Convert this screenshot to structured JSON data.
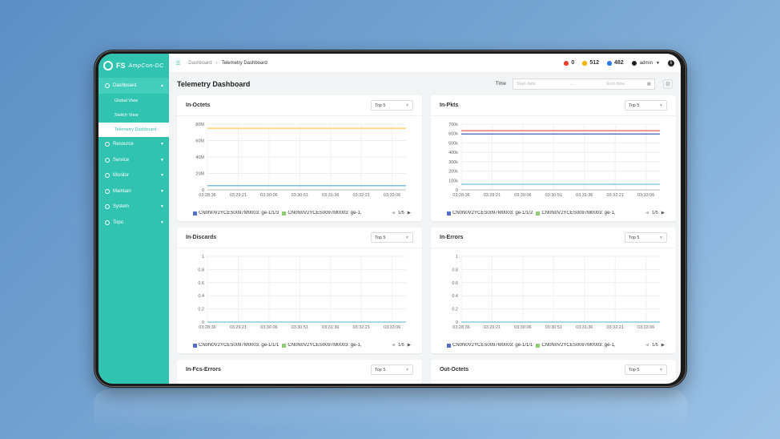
{
  "sidebar": {
    "logo": "FS",
    "product": "AmpCon-DC",
    "items": [
      {
        "label": "Dashboard",
        "icon": "dashboard-icon",
        "open": true,
        "children": [
          {
            "label": "Global View"
          },
          {
            "label": "Switch View"
          },
          {
            "label": "Telemetry Dashboard",
            "active": true
          }
        ]
      },
      {
        "label": "Resource",
        "icon": "globe-icon"
      },
      {
        "label": "Service",
        "icon": "service-icon"
      },
      {
        "label": "Monitor",
        "icon": "monitor-icon"
      },
      {
        "label": "Maintain",
        "icon": "tools-icon"
      },
      {
        "label": "System",
        "icon": "gear-icon"
      },
      {
        "label": "Topo",
        "icon": "topo-icon"
      }
    ]
  },
  "topbar": {
    "breadcrumb": [
      "Dashboard",
      "Telemetry Dashboard"
    ],
    "alerts": [
      {
        "icon": "fire-icon",
        "value": "0",
        "color": "#e8412c"
      },
      {
        "icon": "warning-bell-icon",
        "value": "512",
        "color": "#f5b200"
      },
      {
        "icon": "bell-icon",
        "value": "482",
        "color": "#2f7be6"
      }
    ],
    "user": "admin"
  },
  "page": {
    "title": "Telemetry Dashboard",
    "time_label": "Time",
    "start_placeholder": "Start date",
    "end_placeholder": "End date"
  },
  "colors": {
    "accent": "#30c3b0",
    "series_blue": "#5470c6",
    "series_green": "#91cc75",
    "series_yellow": "#fac858",
    "series_red": "#ee6666",
    "series_teal": "#73c0de"
  },
  "cards": [
    {
      "title": "In-Octets",
      "select": "Top 5",
      "legend": [
        "CN0N0V2YCES0097M0003: ge-1/1/3",
        "CN0N0V2YCES0097M0003: ge-1,"
      ],
      "page": "1/5"
    },
    {
      "title": "In-Pkts",
      "select": "Top 5",
      "legend": [
        "CN0N0V2YCES0097M0003: ge-1/1/2",
        "CN0N0V2YCES0097M0003: ge-1,"
      ],
      "page": "1/5"
    },
    {
      "title": "In-Discards",
      "select": "Top 5",
      "legend": [
        "CN0N0V2YCES0097M0003: ge-1/1/1",
        "CN0N0V2YCES0097M0003: ge-1,"
      ],
      "page": "1/5"
    },
    {
      "title": "In-Errors",
      "select": "Top 5",
      "legend": [
        "CN0N0V2YCES0097M0003: ge-1/1/1",
        "CN0N0V2YCES0097M0003: ge-1,"
      ],
      "page": "1/5"
    },
    {
      "title": "In-Fcs-Errors",
      "select": "Top 5"
    },
    {
      "title": "Out-Octets",
      "select": "Top 5"
    }
  ],
  "chart_data": [
    {
      "type": "line",
      "title": "In-Octets",
      "categories": [
        "03:28:36",
        "03:29:21",
        "03:30:06",
        "03:30:51",
        "03:31:36",
        "03:32:21",
        "03:33:06"
      ],
      "yticks": [
        "0",
        "20M",
        "40M",
        "60M",
        "80M"
      ],
      "ylim": [
        0,
        80000000
      ],
      "series": [
        {
          "color": "#fac858",
          "values": [
            75000000,
            75000000,
            75000000,
            75000000,
            75000000,
            75000000,
            75000000
          ]
        },
        {
          "color": "#5470c6",
          "values": [
            5000000,
            5000000,
            5000000,
            5000000,
            5000000,
            5000000,
            5000000
          ]
        },
        {
          "color": "#73c0de",
          "values": [
            5000000,
            5000000,
            5000000,
            5000000,
            5000000,
            5000000,
            5000000
          ]
        }
      ]
    },
    {
      "type": "line",
      "title": "In-Pkts",
      "categories": [
        "03:28:36",
        "03:29:21",
        "03:30:06",
        "03:30:51",
        "03:31:36",
        "03:32:21",
        "03:33:06"
      ],
      "yticks": [
        "0",
        "100k",
        "200k",
        "300k",
        "400k",
        "500k",
        "600k",
        "700k"
      ],
      "ylim": [
        0,
        700000
      ],
      "series": [
        {
          "color": "#ee6666",
          "values": [
            630000,
            630000,
            630000,
            630000,
            630000,
            630000,
            630000
          ]
        },
        {
          "color": "#5470c6",
          "values": [
            595000,
            595000,
            595000,
            595000,
            595000,
            595000,
            595000
          ]
        },
        {
          "color": "#73c0de",
          "values": [
            60000,
            60000,
            60000,
            60000,
            60000,
            60000,
            60000
          ]
        }
      ]
    },
    {
      "type": "line",
      "title": "In-Discards",
      "categories": [
        "03:28:36",
        "03:29:21",
        "03:30:06",
        "03:30:51",
        "03:31:36",
        "03:32:21",
        "03:33:06"
      ],
      "yticks": [
        "0",
        "0.2",
        "0.4",
        "0.6",
        "0.8",
        "1"
      ],
      "ylim": [
        0,
        1
      ],
      "series": [
        {
          "color": "#73c0de",
          "values": [
            0,
            0,
            0,
            0,
            0,
            0,
            0
          ]
        }
      ]
    },
    {
      "type": "line",
      "title": "In-Errors",
      "categories": [
        "03:28:36",
        "03:29:21",
        "03:30:06",
        "03:30:51",
        "03:31:36",
        "03:32:21",
        "03:33:06"
      ],
      "yticks": [
        "0",
        "0.2",
        "0.4",
        "0.6",
        "0.8",
        "1"
      ],
      "ylim": [
        0,
        1
      ],
      "series": [
        {
          "color": "#73c0de",
          "values": [
            0,
            0,
            0,
            0,
            0,
            0,
            0
          ]
        }
      ]
    }
  ]
}
